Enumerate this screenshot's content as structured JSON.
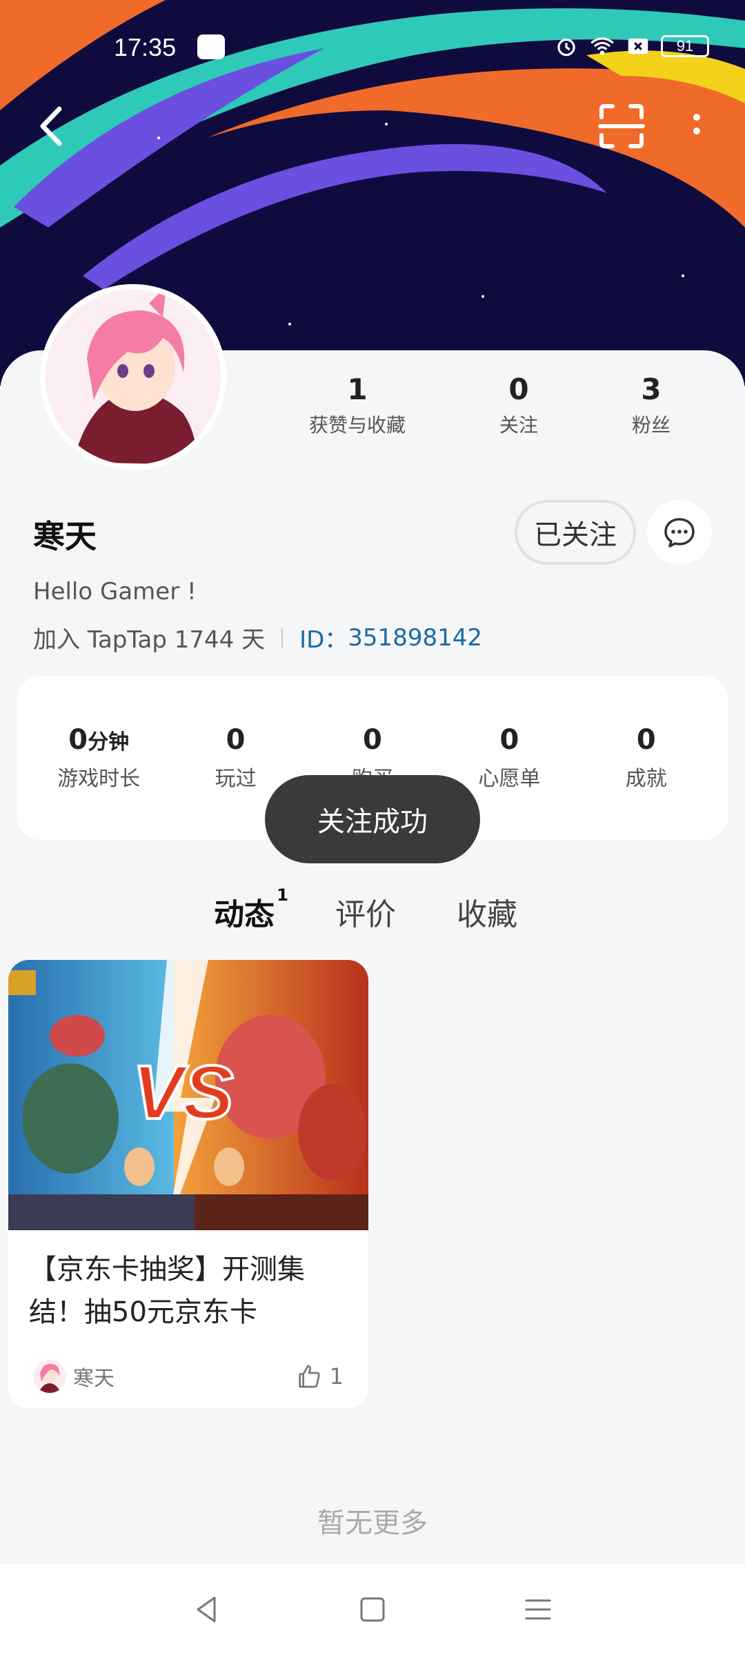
{
  "status_bar": {
    "time": "17:35",
    "battery": "91"
  },
  "profile": {
    "stats": [
      {
        "value": "1",
        "label": "获赞与收藏"
      },
      {
        "value": "0",
        "label": "关注"
      },
      {
        "value": "3",
        "label": "粉丝"
      }
    ],
    "username": "寒天",
    "follow_button": "已关注",
    "bio": "Hello Gamer !",
    "join_text": "加入 TapTap 1744 天",
    "id_label": "ID：",
    "id_value": "351898142"
  },
  "game_stats": [
    {
      "value": "0",
      "unit": "分钟",
      "label": "游戏时长"
    },
    {
      "value": "0",
      "unit": "",
      "label": "玩过"
    },
    {
      "value": "0",
      "unit": "",
      "label": "购买"
    },
    {
      "value": "0",
      "unit": "",
      "label": "心愿单"
    },
    {
      "value": "0",
      "unit": "",
      "label": "成就"
    }
  ],
  "toast": "关注成功",
  "tabs": [
    {
      "label": "动态",
      "badge": "1",
      "active": true
    },
    {
      "label": "评价",
      "badge": "",
      "active": false
    },
    {
      "label": "收藏",
      "badge": "",
      "active": false
    }
  ],
  "post": {
    "title": "【京东卡抽奖】开测集结！抽50元京东卡",
    "author": "寒天",
    "likes": "1"
  },
  "footer_text": "暂无更多",
  "colors": {
    "accent": "#1fd4c4",
    "banner_bg": "#0f0b3e",
    "id_blue": "#1b6aa0"
  }
}
